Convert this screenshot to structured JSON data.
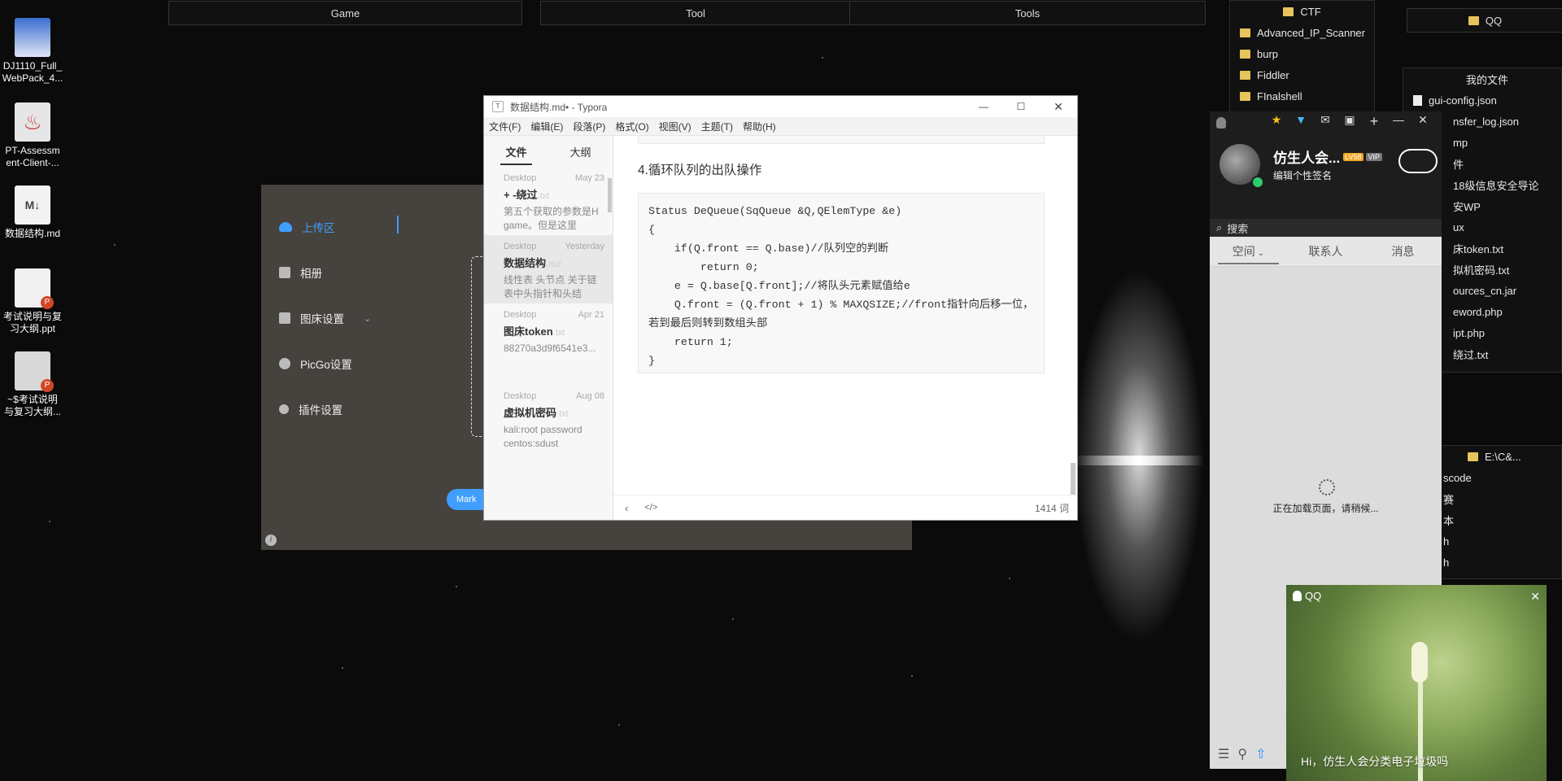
{
  "desktop": {
    "icons": [
      {
        "label": "DJ1110_Full_\nWebPack_4..."
      },
      {
        "label": "PT-Assessm\nent-Client-..."
      },
      {
        "label": "数据结构.md"
      },
      {
        "label": "考试说明与复\n习大纲.ppt"
      },
      {
        "label": "~$考试说明\n与复习大纲..."
      }
    ],
    "fence_bars": [
      "Game",
      "Tool",
      "Tools"
    ],
    "ctf": {
      "title": "CTF",
      "items": [
        "Advanced_IP_Scanner",
        "burp",
        "Fiddler",
        "FInalshell"
      ]
    },
    "qq_fence": {
      "title": "QQ",
      "my_files_title": "我的文件",
      "items": [
        "gui-config.json",
        "nsfer_log.json",
        "mp",
        "件",
        "18级信息安全导论",
        "安WP",
        "ux",
        "床token.txt",
        "拟机密码.txt",
        "ources_cn.jar",
        "eword.php",
        "ipt.php",
        "绕过.txt"
      ]
    },
    "ec_fence": {
      "title": "E:\\C&...",
      "items": [
        "scode",
        "赛",
        "本",
        "h",
        "h"
      ]
    }
  },
  "picgo": {
    "menu": [
      "上传区",
      "相册",
      "图床设置",
      "PicGo设置",
      "插件设置"
    ],
    "button_partial": "Mark"
  },
  "typora": {
    "title": "数据结构.md• - Typora",
    "menu": [
      "文件(F)",
      "编辑(E)",
      "段落(P)",
      "格式(O)",
      "视图(V)",
      "主题(T)",
      "帮助(H)"
    ],
    "tabs": [
      "文件",
      "大纲"
    ],
    "files": [
      {
        "loc": "Desktop",
        "date": "May 23",
        "name": "+ -绕过",
        "ext": ".txt",
        "preview": "第五个获取的参数是H game。但是这里"
      },
      {
        "loc": "Desktop",
        "date": "Yesterday",
        "name": "数据结构",
        "ext": ".md",
        "preview": "线性表 头节点 关于链表中头指针和头结"
      },
      {
        "loc": "Desktop",
        "date": "Apr 21",
        "name": "图床token",
        "ext": ".txt",
        "preview": "88270a3d9f6541e3..."
      },
      {
        "loc": "Desktop",
        "date": "Aug 08",
        "name": "虚拟机密码",
        "ext": ".txt",
        "preview": "kali:root password\ncentos:sdust"
      }
    ],
    "heading": "4.循环队列的出队操作",
    "code": "Status DeQueue(SqQueue &Q,QElemType &e)\n{\n    if(Q.front == Q.base)//队列空的判断\n        return 0;\n    e = Q.base[Q.front];//将队头元素赋值给e\n    Q.front = (Q.front + 1) % MAXQSIZE;//front指针向后移一位，若到最后则转到数组头部\n    return 1;\n}",
    "word_count": "1414 词"
  },
  "qq": {
    "nickname": "仿生人会...",
    "badge_lv": "LV58",
    "badge_vip": "VIP",
    "signature": "编辑个性签名",
    "search_placeholder": "搜索",
    "tabs": [
      "空间",
      "联系人",
      "消息"
    ],
    "loading": "正在加载页面，请稍候...",
    "popup_title": "QQ",
    "popup_text": "Hi，仿生人会分类电子垃圾吗"
  }
}
